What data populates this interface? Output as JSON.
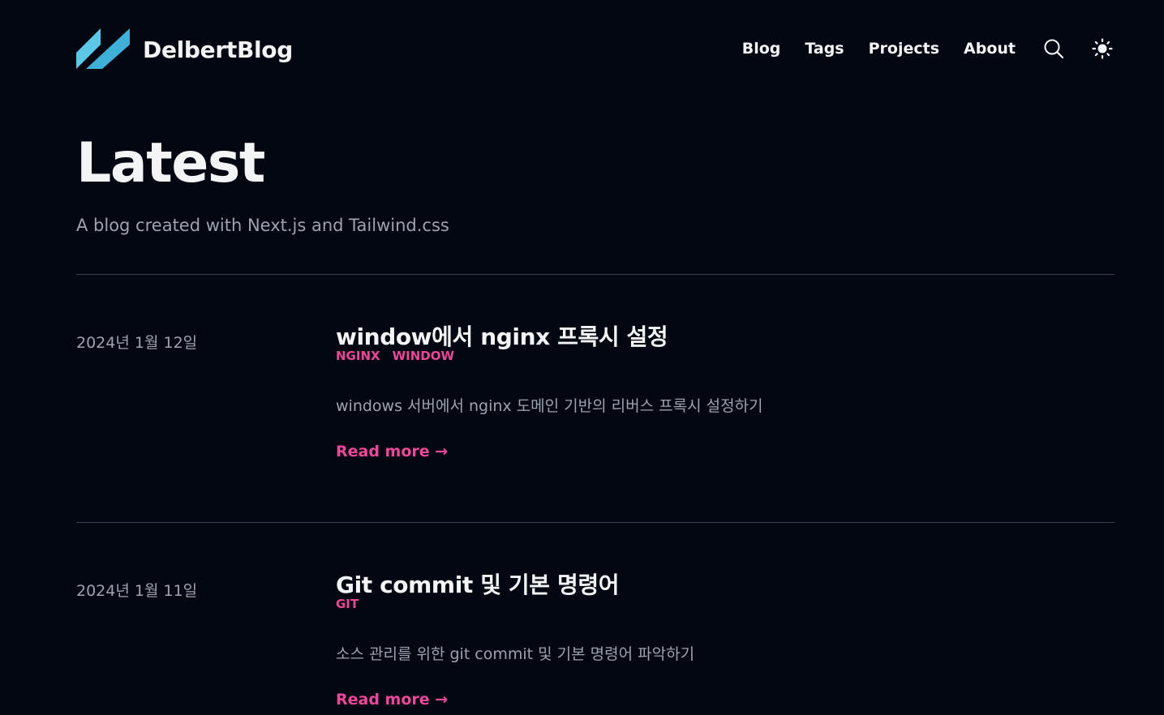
{
  "header": {
    "brand": "DelbertBlog",
    "logo_colors": [
      "#5cc8e8",
      "#3fb1d8"
    ],
    "nav": [
      {
        "label": "Blog"
      },
      {
        "label": "Tags"
      },
      {
        "label": "Projects"
      },
      {
        "label": "About"
      }
    ],
    "search_icon": "search-icon",
    "theme_icon": "sun-icon"
  },
  "hero": {
    "title": "Latest",
    "subtitle": "A blog created with Next.js and Tailwind.css"
  },
  "posts": [
    {
      "date": "2024년 1월 12일",
      "title": "window에서 nginx 프록시 설정",
      "tags": [
        "NGINX",
        "WINDOW"
      ],
      "summary": "windows 서버에서 nginx 도메인 기반의 리버스 프록시 설정하기",
      "read_more": "Read more →"
    },
    {
      "date": "2024년 1월 11일",
      "title": "Git commit 및 기본 명령어",
      "tags": [
        "GIT"
      ],
      "summary": "소스 관리를 위한 git commit 및 기본 명령어 파악하기",
      "read_more": "Read more →"
    }
  ],
  "colors": {
    "background": "#030712",
    "accent": "#ec4899",
    "text": "#f3f4f6",
    "muted": "#9ca3af",
    "divider": "#374151"
  }
}
